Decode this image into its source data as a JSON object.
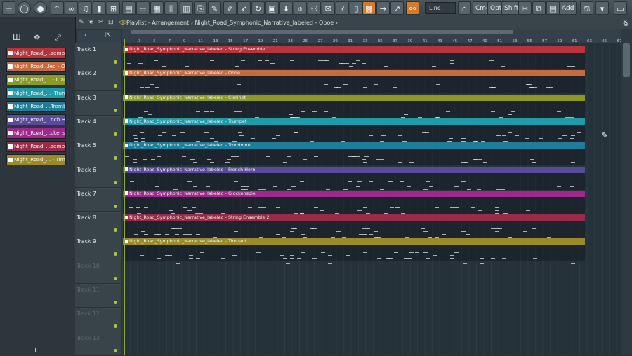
{
  "toolbar": {
    "snap_label": "Line",
    "buttons": [
      "Cmd",
      "Opt",
      "Shift",
      "Add"
    ]
  },
  "playlist": {
    "title": "Playlist - Arrangement › Night_Road_Symphonic_Narrative_labeled - Oboe ›"
  },
  "channels": [
    {
      "label": "Night_Road_...sembie",
      "color": "#b8343c"
    },
    {
      "label": "Night_Road...led - Oboe",
      "color": "#c86a3c"
    },
    {
      "label": "Night_Road_... - Clarinet",
      "color": "#8a9a22"
    },
    {
      "label": "Night_Road_...- Trumpet",
      "color": "#1e9aa8"
    },
    {
      "label": "Night_Road_...Trombone",
      "color": "#1e7d9a"
    },
    {
      "label": "Night_Road_...nch Horn",
      "color": "#5a4a9a"
    },
    {
      "label": "Night_Road_...ckenspiel",
      "color": "#a0288c"
    },
    {
      "label": "Night_Road_...semble 2",
      "color": "#9a2a4a"
    },
    {
      "label": "Night_Road_... - Timpani",
      "color": "#9a8a28"
    }
  ],
  "ruler_numbers": [
    "3",
    "5",
    "7",
    "9",
    "11",
    "13",
    "15",
    "17",
    "19",
    "21",
    "23",
    "25",
    "27",
    "29",
    "31",
    "33",
    "35",
    "37",
    "39",
    "41",
    "43",
    "45",
    "47",
    "49",
    "51",
    "53",
    "55",
    "57",
    "59",
    "61",
    "63",
    "65",
    "67"
  ],
  "tracks": [
    {
      "label": "Track 1",
      "clip": "Night_Road_Symphonic_Narrative_labeled - String Ensemble 1",
      "color": "#b8343c"
    },
    {
      "label": "Track 2",
      "clip": "Night_Road_Symphonic_Narrative_labeled - Oboe",
      "color": "#c86a3c"
    },
    {
      "label": "Track 3",
      "clip": "Night_Road_Symphonic_Narrative_labeled - Clarinet",
      "color": "#8a9a22"
    },
    {
      "label": "Track 4",
      "clip": "Night_Road_Symphonic_Narrative_labeled - Trumpet",
      "color": "#1e9aa8"
    },
    {
      "label": "Track 5",
      "clip": "Night_Road_Symphonic_Narrative_labeled - Trombone",
      "color": "#1e7d9a"
    },
    {
      "label": "Track 6",
      "clip": "Night_Road_Symphonic_Narrative_labeled - French Horn",
      "color": "#5a4a9a"
    },
    {
      "label": "Track 7",
      "clip": "Night_Road_Symphonic_Narrative_labeled - Glockenspiel",
      "color": "#a0288c"
    },
    {
      "label": "Track 8",
      "clip": "Night_Road_Symphonic_Narrative_labeled - String Ensemble 2",
      "color": "#9a2a4a"
    },
    {
      "label": "Track 9",
      "clip": "Night_Road_Symphonic_Narrative_labeled - Timpani",
      "color": "#9a8a28"
    },
    {
      "label": "Track 10",
      "clip": "",
      "color": ""
    },
    {
      "label": "Track 11",
      "clip": "",
      "color": ""
    },
    {
      "label": "Track 12",
      "clip": "",
      "color": ""
    },
    {
      "label": "Track 13",
      "clip": "",
      "color": ""
    }
  ]
}
